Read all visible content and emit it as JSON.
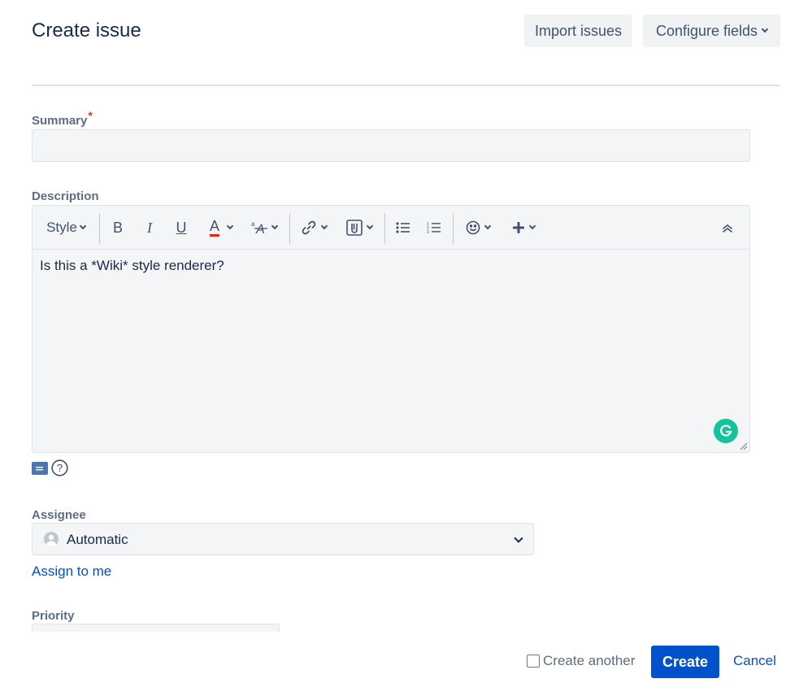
{
  "dialog": {
    "title": "Create issue",
    "import_label": "Import issues",
    "configure_label": "Configure fields"
  },
  "summary": {
    "label": "Summary",
    "required_mark": "*",
    "value": ""
  },
  "description": {
    "label": "Description",
    "toolbar": {
      "style_label": "Style",
      "bold": "B",
      "italic": "I",
      "underline": "U",
      "text_color": "A",
      "text_color_underline": "#e5231c",
      "icons": [
        "bold-icon",
        "italic-icon",
        "underline-icon",
        "text-color-icon",
        "text-effects-icon",
        "link-icon",
        "attachment-icon",
        "bullet-list-icon",
        "numbered-list-icon",
        "emoji-icon",
        "insert-more-icon",
        "collapse-toolbar-icon"
      ]
    },
    "content": "Is this a *Wiki* style renderer?"
  },
  "assignee": {
    "label": "Assignee",
    "value": "Automatic",
    "assign_to_me": "Assign to me"
  },
  "priority": {
    "label": "Priority"
  },
  "footer": {
    "create_another": "Create another",
    "create_label": "Create",
    "cancel_label": "Cancel"
  },
  "colors": {
    "primary": "#0052cc",
    "grammarly": "#15c39a",
    "required": "#de350b"
  }
}
